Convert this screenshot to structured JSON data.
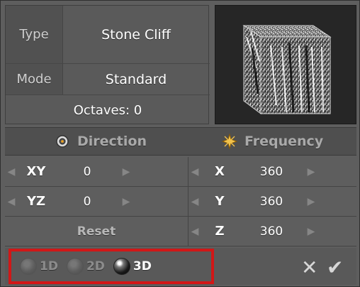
{
  "panel": {
    "type_label": "Type",
    "type_value": "Stone Cliff",
    "mode_label": "Mode",
    "mode_value": "Standard",
    "octaves": "Octaves: 0"
  },
  "sections": {
    "direction": "Direction",
    "frequency": "Frequency"
  },
  "direction_rows": [
    {
      "axis": "XY",
      "value": "0"
    },
    {
      "axis": "YZ",
      "value": "0"
    }
  ],
  "frequency_rows": [
    {
      "axis": "X",
      "value": "360"
    },
    {
      "axis": "Y",
      "value": "360"
    },
    {
      "axis": "Z",
      "value": "360"
    }
  ],
  "reset": "Reset",
  "dimension": {
    "options": [
      "1D",
      "2D",
      "3D"
    ],
    "selected": "3D"
  },
  "actions": {
    "cancel_icon": "x-icon",
    "confirm_icon": "check-icon"
  },
  "colors": {
    "highlight": "#d11717"
  }
}
